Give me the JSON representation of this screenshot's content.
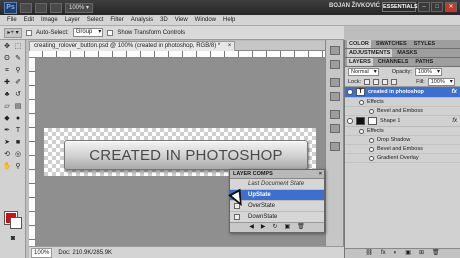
{
  "titlebar": {
    "app_logo": "Ps",
    "user": "BOJAN ŽIVKOVIĆ",
    "workspace": "ESSENTIALS",
    "min": "–",
    "max": "□",
    "close": "✕"
  },
  "menu": [
    "File",
    "Edit",
    "Image",
    "Layer",
    "Select",
    "Filter",
    "Analysis",
    "3D",
    "View",
    "Window",
    "Help"
  ],
  "options": {
    "auto_select_label": "Auto-Select:",
    "auto_select_value": "Group",
    "show_transform_label": "Show Transform Controls"
  },
  "document": {
    "tab_title": "creating_rolover_button.psd @ 100% (created in photoshop, RGB/8) *",
    "tab_close": "×",
    "button_text": "CREATED IN PHOTOSHOP"
  },
  "status": {
    "zoom": "100%",
    "doc": "Doc: 210.9K/285.9K"
  },
  "layer_comps": {
    "title": "LAYER COMPS",
    "close": "×",
    "items": [
      {
        "label": "Last Document State"
      },
      {
        "label": "UpState"
      },
      {
        "label": "OverState"
      },
      {
        "label": "DownState"
      }
    ],
    "footer_icons": [
      "◀",
      "▶",
      "↻",
      "▣",
      "🗑"
    ]
  },
  "panels": {
    "color_tabs": [
      "COLOR",
      "SWATCHES",
      "STYLES"
    ],
    "adjust_tabs": [
      "ADJUSTMENTS",
      "MASKS"
    ],
    "layer_tabs": [
      "LAYERS",
      "CHANNELS",
      "PATHS"
    ],
    "blend_mode": "Normal",
    "opacity_label": "Opacity:",
    "opacity_value": "100%",
    "lock_label": "Lock:",
    "fill_label": "Fill:",
    "fill_value": "100%"
  },
  "layers": [
    {
      "name": "created in photoshop",
      "type": "text",
      "fx": "fx"
    },
    {
      "name": "Shape 1",
      "type": "shape",
      "fx": "fx"
    }
  ],
  "layer_effects": {
    "text_effects_label": "Effects",
    "text_effects": [
      "Bevel and Emboss"
    ],
    "shape_effects_label": "Effects",
    "shape_effects": [
      "Drop Shadow",
      "Bevel and Emboss",
      "Gradient Overlay"
    ]
  },
  "layers_footer_icons": [
    "⛓",
    "fx",
    "◐",
    "▣",
    "⊞",
    "🗑"
  ],
  "colors": {
    "foreground": "#cc1111",
    "background": "#ffffff",
    "selection": "#3d6fcf",
    "titlebar": "#2e2e2e"
  }
}
